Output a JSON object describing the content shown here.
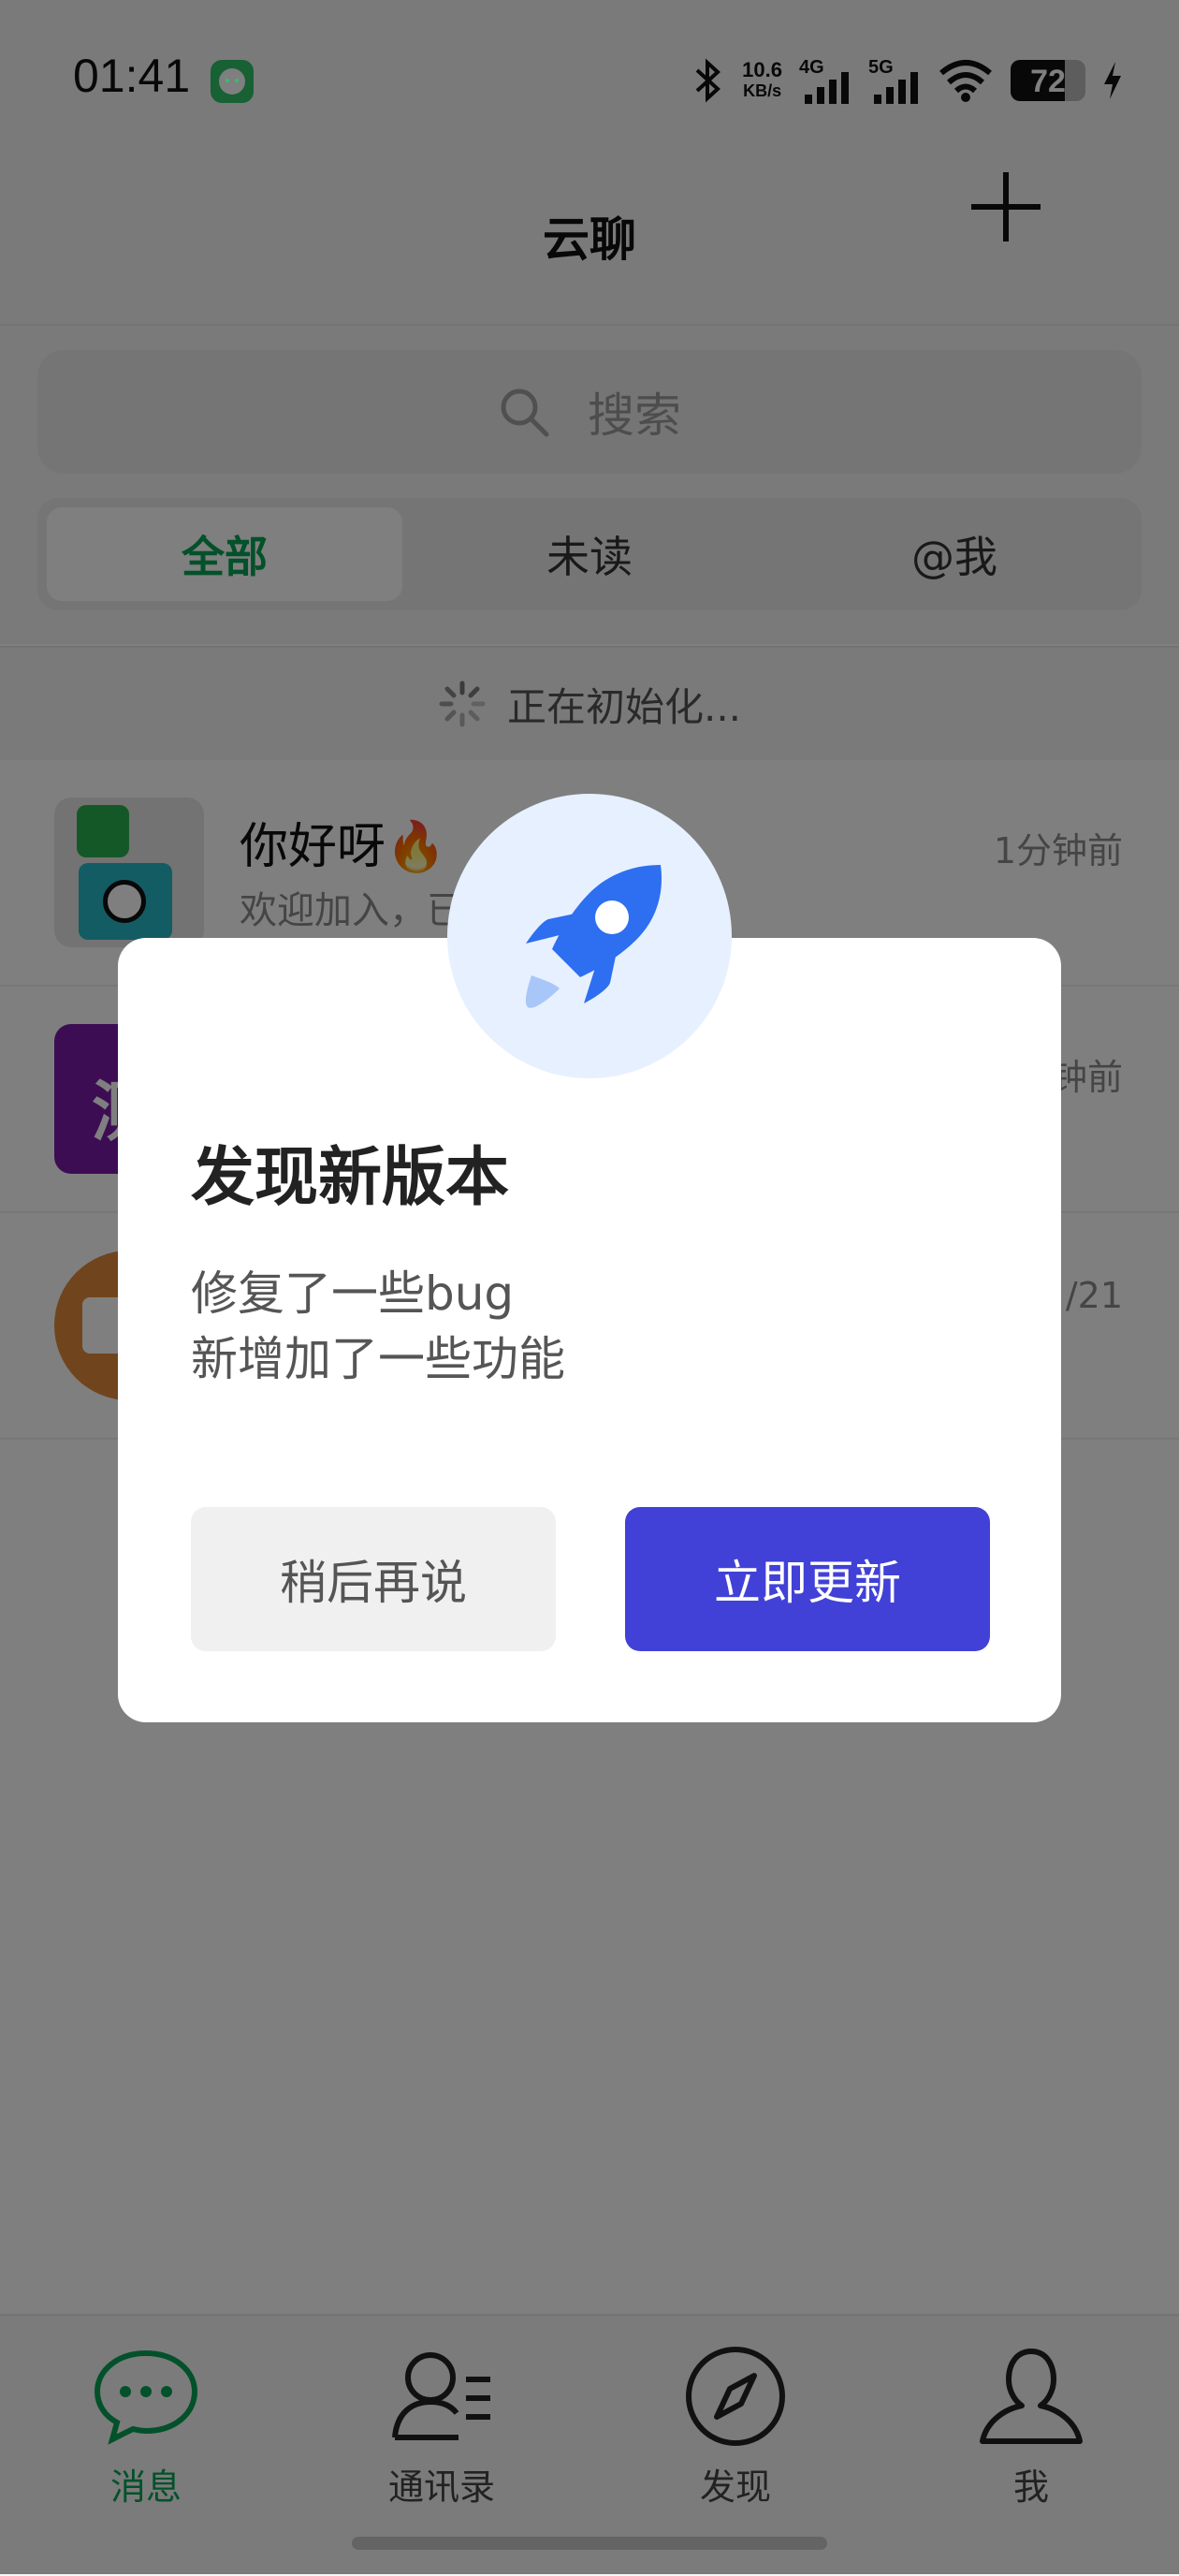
{
  "status_bar": {
    "time": "01:41",
    "net_speed_value": "10.6",
    "net_speed_unit": "KB/s",
    "signal_1_label": "4G",
    "signal_2_label": "5G",
    "battery_level": "72"
  },
  "header": {
    "title": "云聊"
  },
  "search": {
    "placeholder": "搜索"
  },
  "tabs": [
    {
      "label": "全部",
      "active": true
    },
    {
      "label": "未读",
      "active": false
    },
    {
      "label": "@我",
      "active": false
    }
  ],
  "init_status": "正在初始化...",
  "conversations": [
    {
      "name": "你好呀🔥",
      "preview": "欢迎加入，已经成为好友。",
      "time": "1分钟前"
    },
    {
      "name": "",
      "avatar_char": "测",
      "preview": "",
      "time": "钟前"
    },
    {
      "name": "",
      "preview": "",
      "time": "/21"
    }
  ],
  "dialog": {
    "title": "发现新版本",
    "message_lines": [
      "修复了一些bug",
      "新增加了一些功能"
    ],
    "later_label": "稍后再说",
    "update_label": "立即更新"
  },
  "bottom_nav": [
    {
      "label": "消息",
      "icon": "chat-bubble-icon",
      "active": true
    },
    {
      "label": "通讯录",
      "icon": "contacts-icon",
      "active": false
    },
    {
      "label": "发现",
      "icon": "compass-icon",
      "active": false
    },
    {
      "label": "我",
      "icon": "person-icon",
      "active": false
    }
  ],
  "colors": {
    "accent_green": "#07a254",
    "update_button": "#4141d8",
    "rocket_blue": "#2d6ff0"
  }
}
